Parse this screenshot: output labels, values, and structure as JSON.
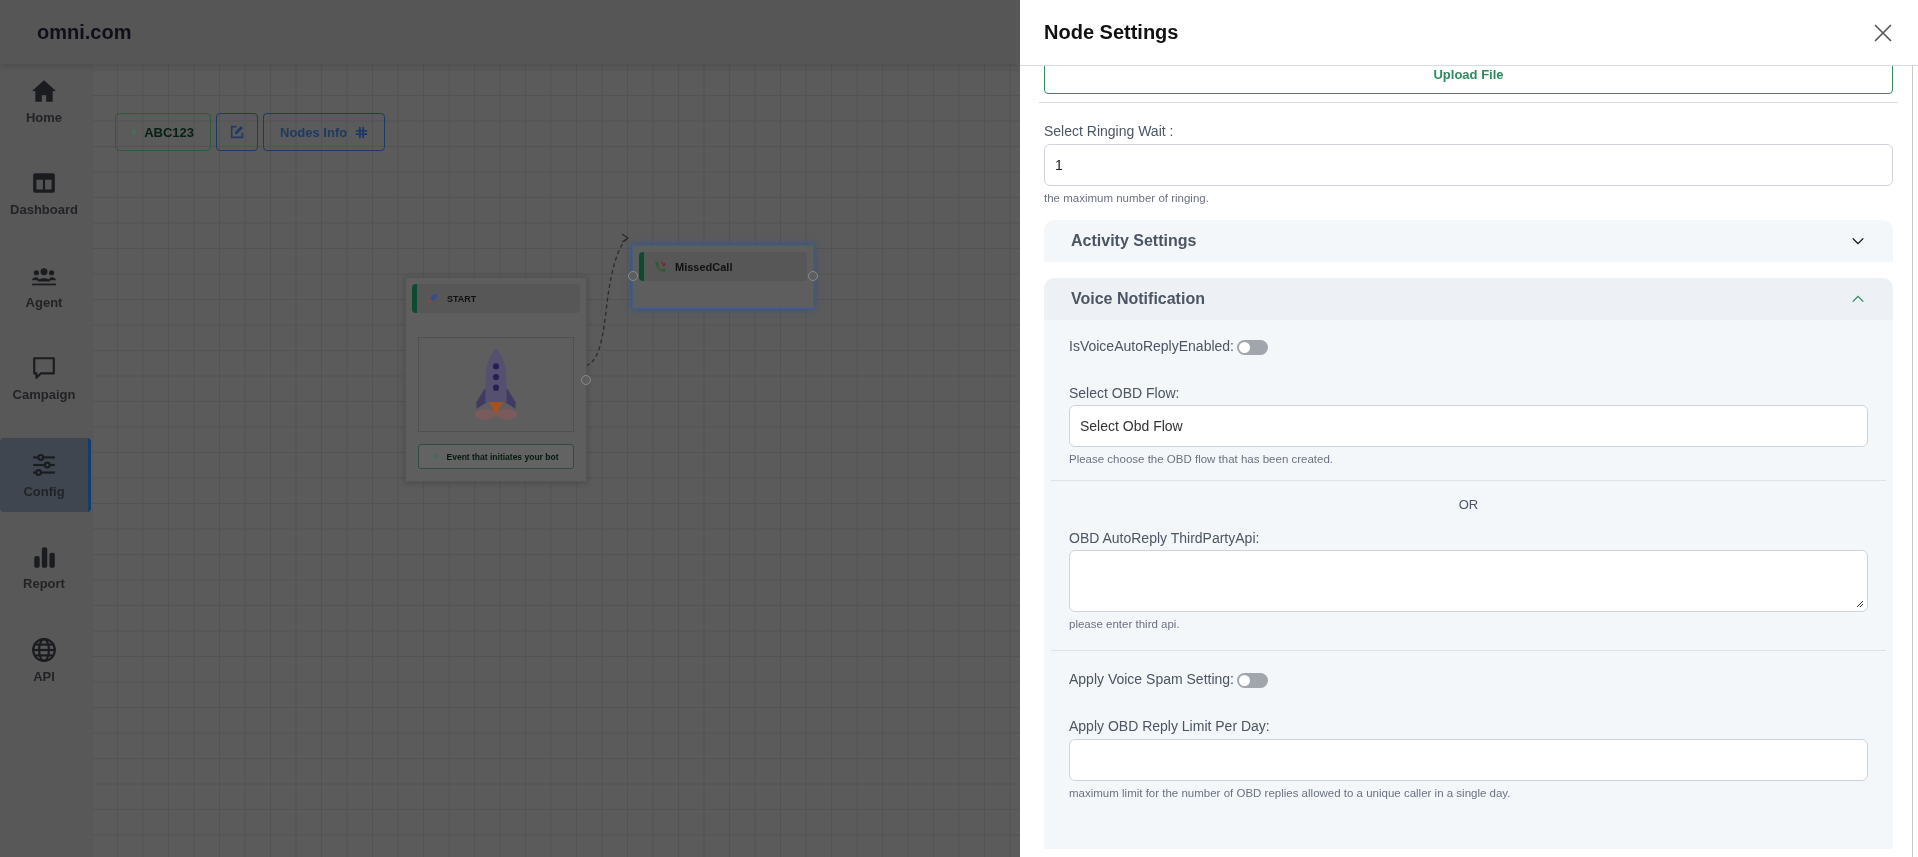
{
  "app": {
    "logo": "omni.com"
  },
  "sidebar": {
    "items": [
      {
        "label": "Home",
        "selected": false
      },
      {
        "label": "Dashboard",
        "selected": false
      },
      {
        "label": "Agent",
        "selected": false
      },
      {
        "label": "Campaign",
        "selected": false
      },
      {
        "label": "Config",
        "selected": true
      },
      {
        "label": "Report",
        "selected": false
      },
      {
        "label": "API",
        "selected": false
      }
    ]
  },
  "toolbar": {
    "flow_name": "ABC123",
    "nodes_info": "Nodes Info"
  },
  "canvas": {
    "nodes": [
      {
        "kind": "start",
        "title": "START",
        "caption": "Event that initiates your bot",
        "selected": false
      },
      {
        "kind": "missed_call",
        "title": "MissedCall",
        "selected": true
      }
    ]
  },
  "panel": {
    "title": "Node Settings",
    "upload_button": "Upload File",
    "ringing_wait": {
      "label": "Select Ringing Wait :",
      "value": "1",
      "hint": "the maximum number of ringing."
    },
    "sections": [
      {
        "title": "Activity Settings",
        "expanded": false
      },
      {
        "title": "Voice Notification",
        "expanded": true,
        "fields": [
          {
            "kind": "toggle",
            "label": "IsVoiceAutoReplyEnabled:",
            "on": false
          },
          {
            "kind": "select",
            "label": "Select OBD Flow:",
            "value": "Select Obd Flow",
            "hint": "Please choose the OBD flow that has been created."
          },
          {
            "kind": "separator",
            "text": "OR"
          },
          {
            "kind": "textarea",
            "label": "OBD AutoReply ThirdPartyApi:",
            "hint": "please enter third api."
          },
          {
            "kind": "rule"
          },
          {
            "kind": "toggle",
            "label": "Apply Voice Spam Setting:",
            "on": false
          },
          {
            "kind": "input",
            "label": "Apply OBD Reply Limit Per Day:",
            "hint": "maximum limit for the number of OBD replies allowed to a unique caller in a single day."
          }
        ]
      }
    ]
  }
}
